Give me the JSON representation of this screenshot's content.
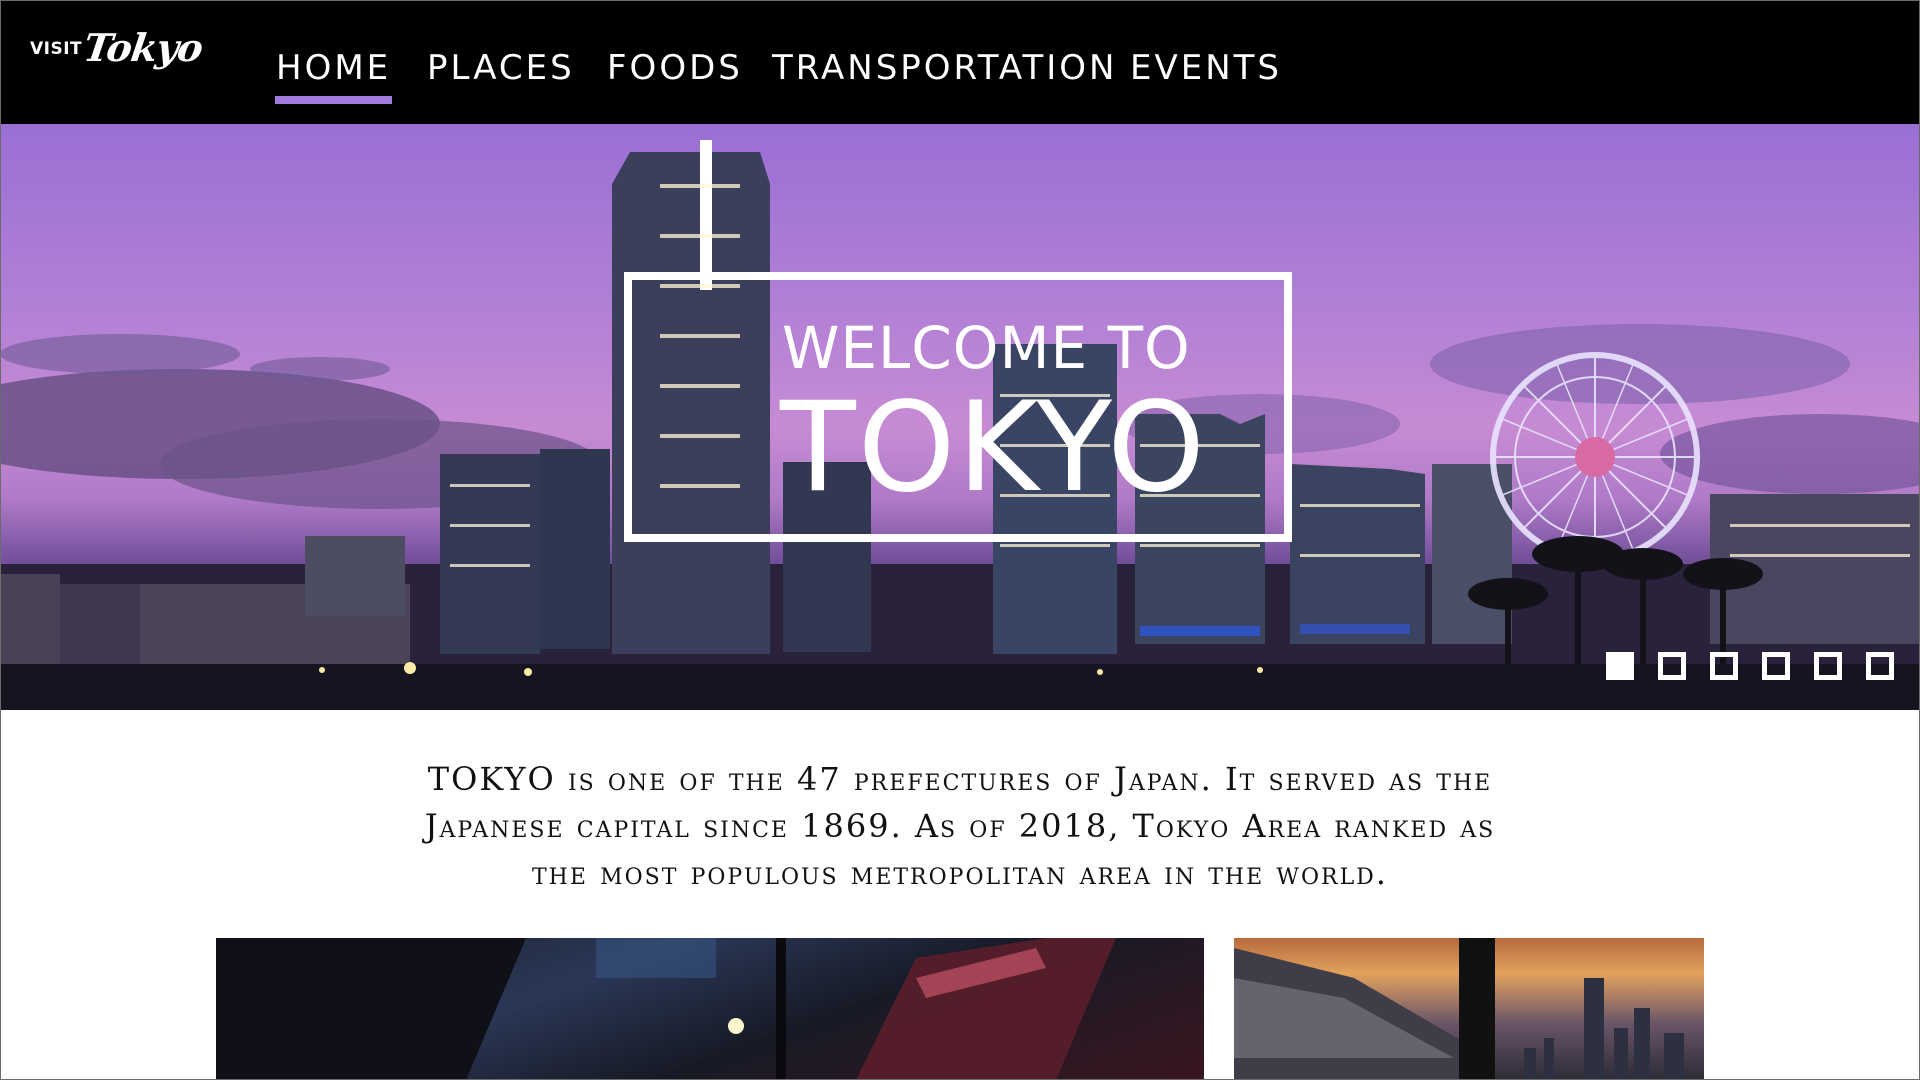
{
  "brand": {
    "visit": "VISIT",
    "name": "Tokyo"
  },
  "nav": {
    "items": [
      {
        "label": "HOME",
        "active": true
      },
      {
        "label": "PLACES",
        "active": false
      },
      {
        "label": "FOODS",
        "active": false
      },
      {
        "label": "TRANSPORTATION",
        "active": false
      },
      {
        "label": "EVENTS",
        "active": false
      }
    ]
  },
  "hero": {
    "subtitle": "WELCOME TO",
    "title": "TOKYO",
    "slides_count": 6,
    "active_slide": 1
  },
  "intro": {
    "lines": [
      "TOKYO is one of the 47 prefectures of Japan. It served as the",
      "Japanese capital since 1869. As of 2018, Tokyo Area ranked as",
      "the most populous metropolitan area in the world."
    ]
  },
  "colors": {
    "accent": "#9e7bdc",
    "nav_bg": "#000000"
  }
}
